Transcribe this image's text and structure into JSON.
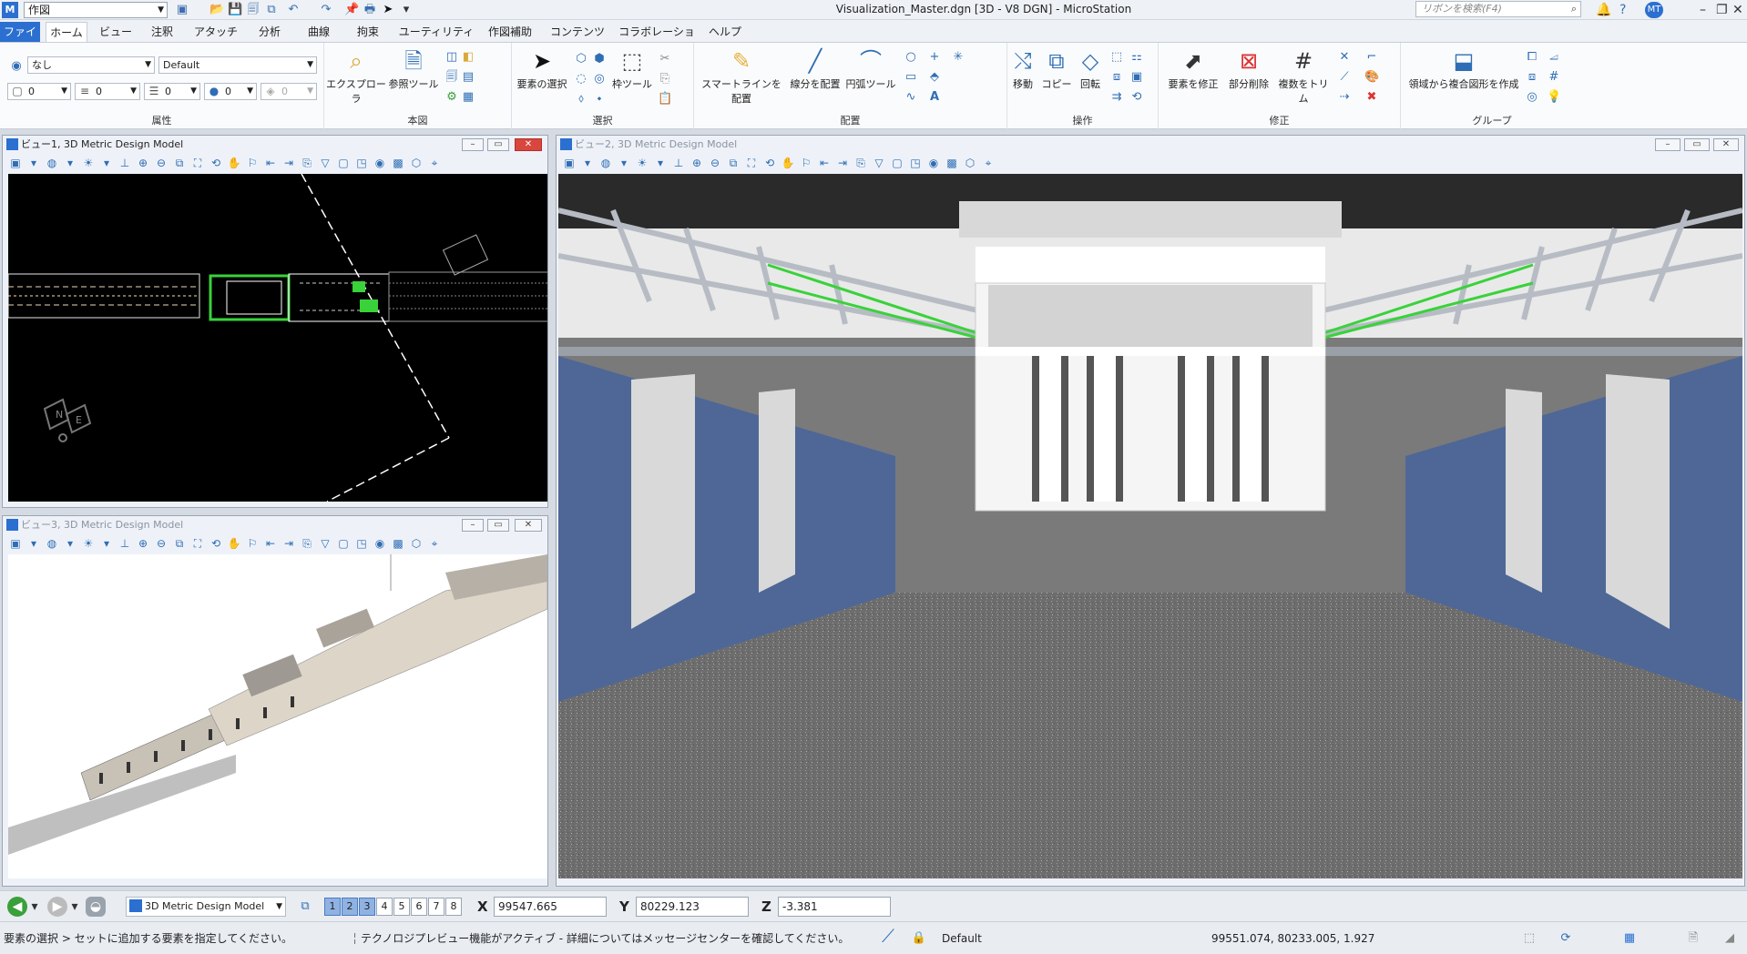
{
  "app": {
    "title": "Visualization_Master.dgn [3D - V8 DGN] - MicroStation",
    "workflow": "作図",
    "search_placeholder": "リボンを検索(F4)",
    "user_badge": "MT"
  },
  "menu": {
    "tabs": [
      "ファイル",
      "ホーム",
      "ビュー",
      "注釈",
      "アタッチ",
      "分析",
      "曲線",
      "拘束",
      "ユーティリティ",
      "作図補助",
      "コンテンツ",
      "コラボレーション",
      "ヘルプ"
    ],
    "active": "ホーム"
  },
  "ribbon": {
    "attributes": {
      "label": "属性",
      "level": "なし",
      "style": "Default",
      "color": "0",
      "line_style": "0",
      "weight": "0",
      "transparency": "0",
      "priority": "0"
    },
    "primary": {
      "label": "本図",
      "explorer": "エクスプローラ",
      "reference": "参照ツール"
    },
    "selection": {
      "label": "選択",
      "select_element": "要素の選択",
      "fence_tools": "枠ツール"
    },
    "placement": {
      "label": "配置",
      "smartline": "スマートラインを配置",
      "line": "線分を配置",
      "arc": "円弧ツール"
    },
    "manipulate": {
      "label": "操作",
      "move": "移動",
      "copy": "コピー",
      "rotate": "回転"
    },
    "modify": {
      "label": "修正",
      "modify_element": "要素を修正",
      "partial_delete": "部分削除",
      "trim_multiple": "複数をトリム"
    },
    "groups": {
      "label": "グループ",
      "create_region": "領域から複合図形を作成"
    }
  },
  "views": {
    "v1": {
      "title": "ビュー1, 3D Metric Design Model"
    },
    "v2": {
      "title": "ビュー2, 3D Metric Design Model"
    },
    "v3": {
      "title": "ビュー3, 3D Metric Design Model"
    },
    "v1_compass": {
      "n": "N",
      "e": "E"
    }
  },
  "status": {
    "model": "3D Metric Design Model",
    "view_numbers": [
      "1",
      "2",
      "3",
      "4",
      "5",
      "6",
      "7",
      "8"
    ],
    "active_views": [
      "1",
      "2",
      "3"
    ],
    "x_label": "X",
    "x": "99547.665",
    "y_label": "Y",
    "y": "80229.123",
    "z_label": "Z",
    "z": "-3.381",
    "prompt": "要素の選択 > セットに追加する要素を指定してください。",
    "message": "テクノロジプレビュー機能がアクティブ - 詳細についてはメッセージセンターを確認してください。",
    "active_level": "Default",
    "cursor_coords": "99551.074, 80233.005, 1.927"
  },
  "colors": {
    "accent": "#2b6fd0",
    "view_bg_dark": "#000000",
    "highlight_green": "#39d23a",
    "wall_blue": "#4e6797",
    "floor_gray": "#6c6c6c"
  }
}
